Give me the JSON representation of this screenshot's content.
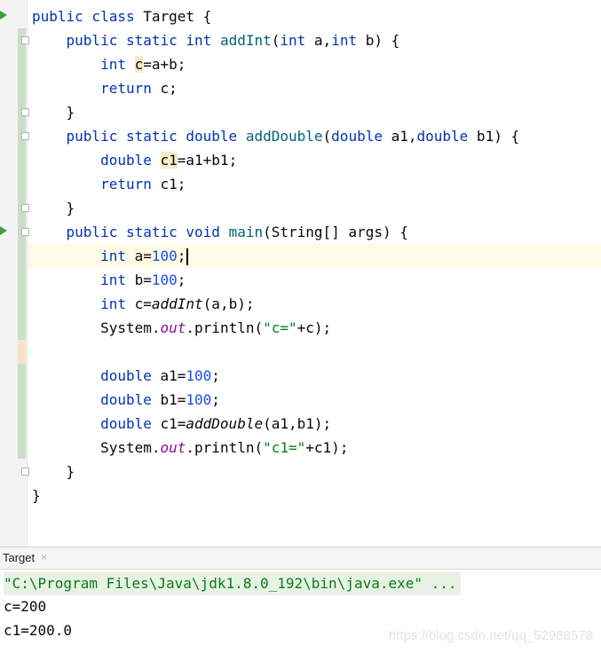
{
  "editor": {
    "lines": {
      "l1": {
        "kw": "public class",
        "text": " Target {"
      },
      "l2": {
        "kw1": "public static int",
        "fn": "addInt",
        "p1": "(",
        "kw2": "int",
        "p2": " a,",
        "kw3": "int",
        "p3": " b) {"
      },
      "l3": {
        "kw": "int",
        "sp": " ",
        "var": "c",
        "rest": "=a+b;"
      },
      "l4": {
        "kw": "return",
        "rest": " c;"
      },
      "l5": {
        "text": "}"
      },
      "l6": {
        "kw1": "public static double",
        "fn": "addDouble",
        "p1": "(",
        "kw2": "double",
        "p2": " a1,",
        "kw3": "double",
        "p3": " b1) {"
      },
      "l7": {
        "kw": "double",
        "sp": " ",
        "var": "c1",
        "rest": "=a1+b1;"
      },
      "l8": {
        "kw": "return",
        "rest": " c1;"
      },
      "l9": {
        "text": "}"
      },
      "l10": {
        "kw1": "public static void",
        "fn": "main",
        "rest": "(String[] args) {"
      },
      "l11": {
        "kw": "int",
        "a": " a=",
        "num": "100",
        "rest": ";"
      },
      "l12": {
        "kw": "int",
        "a": " b=",
        "num": "100",
        "rest": ";"
      },
      "l13": {
        "kw": "int",
        "a": " c=",
        "call": "addInt",
        "rest": "(a,b);"
      },
      "l14": {
        "a": "System.",
        "field": "out",
        "b": ".println(",
        "str": "\"c=\"",
        "rest": "+c);"
      },
      "l15": {
        "kw": "double",
        "a": " a1=",
        "num": "100",
        "rest": ";"
      },
      "l16": {
        "kw": "double",
        "a": " b1=",
        "num": "100",
        "rest": ";"
      },
      "l17": {
        "kw": "double",
        "a": " c1=",
        "call": "addDouble",
        "rest": "(a1,b1);"
      },
      "l18": {
        "a": "System.",
        "field": "out",
        "b": ".println(",
        "str": "\"c1=\"",
        "rest": "+c1);"
      },
      "l19": {
        "text": "}"
      },
      "l20": {
        "text": "}"
      }
    }
  },
  "run_panel": {
    "tab_label": "Target",
    "close_glyph": "×",
    "command": "\"C:\\Program Files\\Java\\jdk1.8.0_192\\bin\\java.exe\" ...",
    "output": [
      "c=200",
      "c1=200.0"
    ]
  },
  "watermark": "https://blog.csdn.net/qq_52988578",
  "icons": {
    "run": "run-gutter-icon",
    "fold": "fold-icon"
  }
}
